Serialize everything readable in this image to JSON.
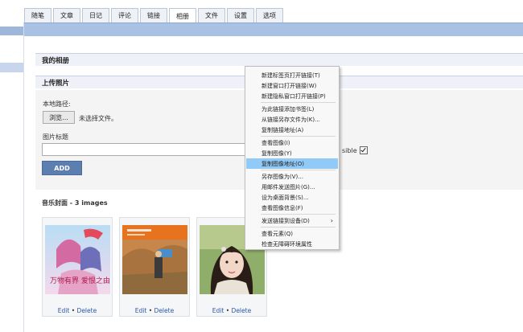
{
  "tabs": [
    "随笔",
    "文章",
    "日记",
    "评论",
    "链接",
    "相册",
    "文件",
    "设置",
    "选项"
  ],
  "active_tab": "相册",
  "page": {
    "title": "我的相册",
    "upload_heading": "上传照片"
  },
  "upload": {
    "local_image_label": "本地路径:",
    "browse_label": "浏览...",
    "no_file_text": "未选择文件。",
    "title_label": "图片标题",
    "title_value": "",
    "add_label": "ADD",
    "visible_label": "sible",
    "visible_checked": true
  },
  "album": {
    "title": "音乐封面 - 3 images",
    "photos": [
      {
        "edit": "Edit",
        "sep": "•",
        "delete": "Delete",
        "thumb_text": "万物有界 爱恨之由"
      },
      {
        "edit": "Edit",
        "sep": "•",
        "delete": "Delete",
        "thumb_text": ""
      },
      {
        "edit": "Edit",
        "sep": "•",
        "delete": "Delete",
        "thumb_text": ""
      }
    ]
  },
  "context_menu": {
    "items": [
      "新建标签页打开链接(T)",
      "新建窗口打开链接(W)",
      "新建隐私窗口打开链接(P)",
      "为此链接添加书签(L)",
      "从链接另存文件为(K)...",
      "复制链接地址(A)",
      "查看图像(I)",
      "复制图像(Y)",
      "复制图像地址(O)",
      "另存图像为(V)...",
      "用邮件发送图片(G)...",
      "设为桌面背景(S)...",
      "查看图像信息(F)",
      "发送链接到设备(D)",
      "查看元素(Q)",
      "检查无障碍环境属性"
    ],
    "highlighted": "复制图像地址(O)"
  },
  "colors": {
    "topbar": "#a9c1e3",
    "add_button": "#5c7faf",
    "menu_highlight": "#91c9f7",
    "link": "#2a58a8"
  }
}
